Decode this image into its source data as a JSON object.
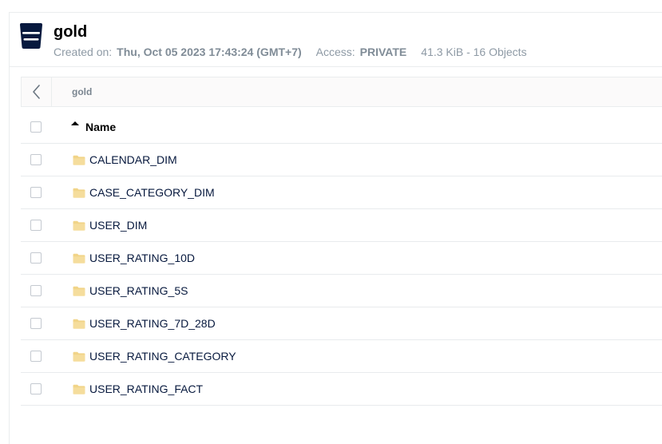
{
  "bucket": {
    "name": "gold",
    "created_label": "Created on:",
    "created_value": "Thu, Oct 05 2023 17:43:24 (GMT+7)",
    "access_label": "Access:",
    "access_value": "PRIVATE",
    "size_summary": "41.3 KiB - 16 Objects",
    "icon": "bucket-icon"
  },
  "breadcrumb": {
    "back_icon": "chevron-left-icon",
    "path": "gold"
  },
  "table": {
    "name_header": "Name",
    "sort_icon": "sort-ascending-icon",
    "folder_icon": "folder-icon",
    "rows": [
      {
        "name": "CALENDAR_DIM"
      },
      {
        "name": "CASE_CATEGORY_DIM"
      },
      {
        "name": "USER_DIM"
      },
      {
        "name": "USER_RATING_10D"
      },
      {
        "name": "USER_RATING_5S"
      },
      {
        "name": "USER_RATING_7D_28D"
      },
      {
        "name": "USER_RATING_CATEGORY"
      },
      {
        "name": "USER_RATING_FACT"
      }
    ]
  },
  "colors": {
    "brand_dark": "#07193e",
    "folder": "#f1d488",
    "border": "#eaedee",
    "muted_text": "#8e9aa5"
  }
}
